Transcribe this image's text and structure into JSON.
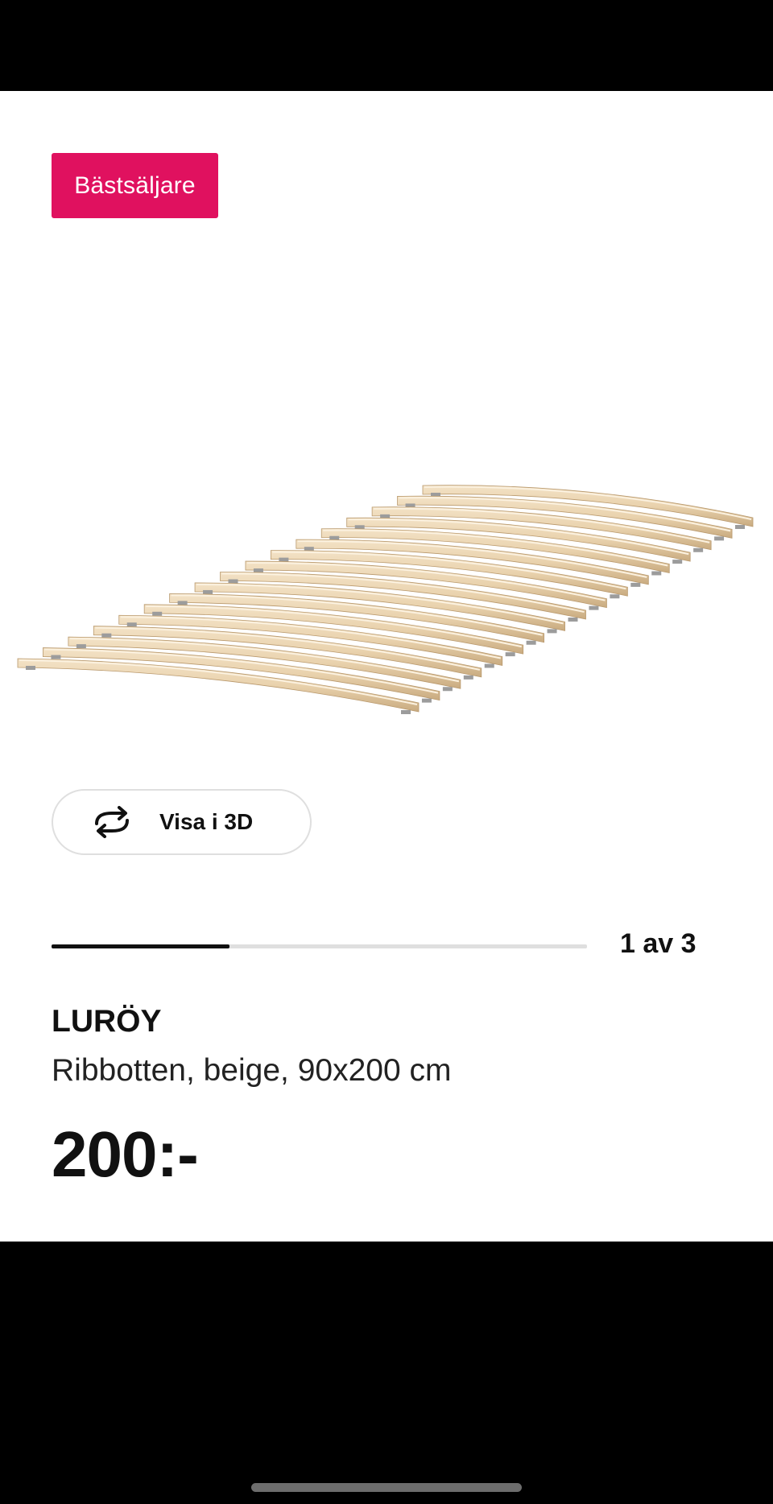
{
  "badge": {
    "label": "Bästsäljare",
    "color": "#e0115f"
  },
  "product_image": {
    "subject": "slatted bed base",
    "icon": "product-photo"
  },
  "view_3d": {
    "label": "Visa i 3D",
    "icon": "rotate-3d-icon"
  },
  "gallery": {
    "current": 1,
    "total": 3,
    "label": "1 av 3",
    "progress_fraction": 0.333
  },
  "product": {
    "name": "LURÖY",
    "description": "Ribbotten, beige, 90x200 cm",
    "price": "200:-"
  }
}
